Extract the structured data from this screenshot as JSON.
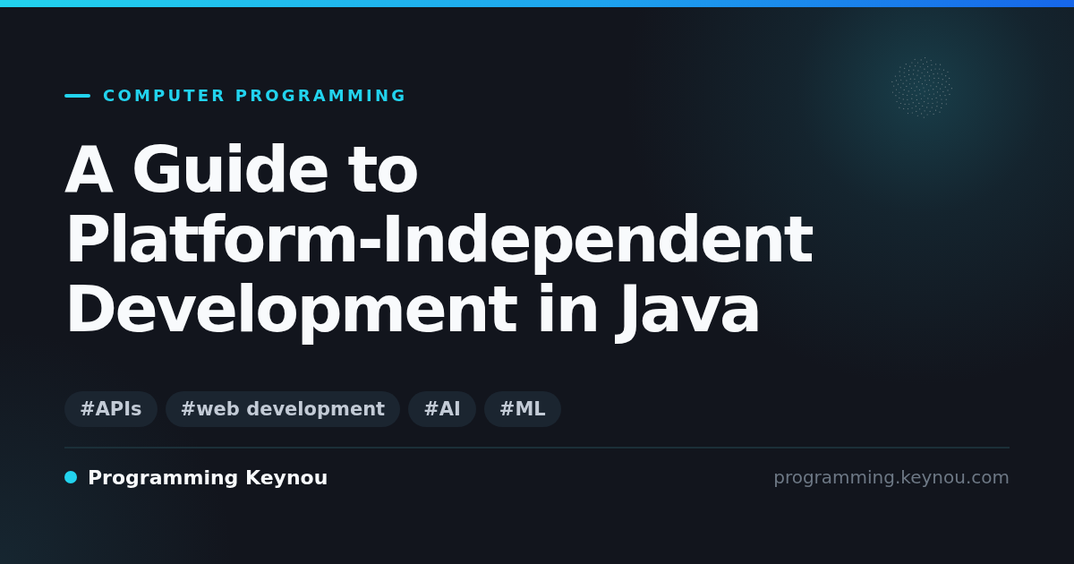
{
  "kicker": "COMPUTER PROGRAMMING",
  "title_lines": [
    "A Guide to",
    "Platform-Independent",
    "Development in Java"
  ],
  "tags": [
    "#APIs",
    "#web development",
    "#AI",
    "#ML"
  ],
  "footer": {
    "brand": "Programming Keynou",
    "url": "programming.keynou.com"
  }
}
